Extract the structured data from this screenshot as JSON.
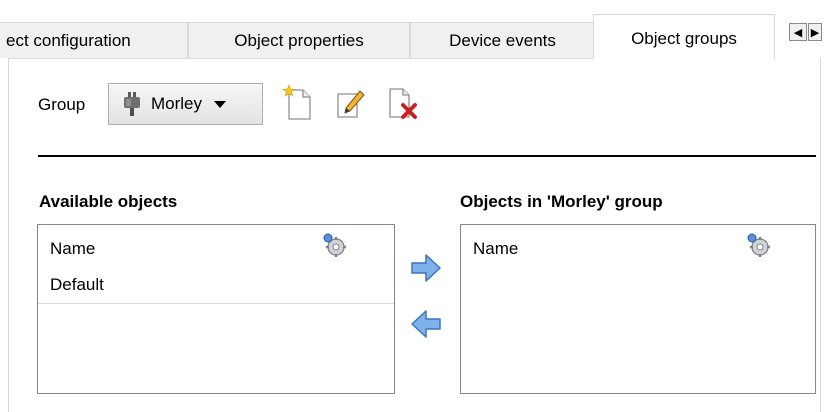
{
  "tabs": [
    {
      "label": "ect configuration",
      "active": false
    },
    {
      "label": "Object properties",
      "active": false
    },
    {
      "label": "Device events",
      "active": false
    },
    {
      "label": "Object groups",
      "active": true
    }
  ],
  "tab_scroll": {
    "left_icon": "triangle-left-icon",
    "right_icon": "triangle-right-icon"
  },
  "group": {
    "label": "Group",
    "selected": "Morley",
    "selected_icon": "plug-icon",
    "toolbar": {
      "new_icon": "new-document-icon",
      "edit_icon": "edit-icon",
      "delete_icon": "delete-document-icon"
    }
  },
  "available": {
    "title": "Available objects",
    "column": "Name",
    "settings_icon": "gear-icon",
    "rows": [
      "Default"
    ]
  },
  "in_group": {
    "title": "Objects in 'Morley' group",
    "column": "Name",
    "settings_icon": "gear-icon",
    "rows": []
  },
  "move_buttons": {
    "add_icon": "arrow-right-icon",
    "remove_icon": "arrow-left-icon"
  },
  "colors": {
    "arrow_blue": "#5b9bd5",
    "delete_red": "#cc1f1f",
    "new_yellow": "#f3c623"
  }
}
